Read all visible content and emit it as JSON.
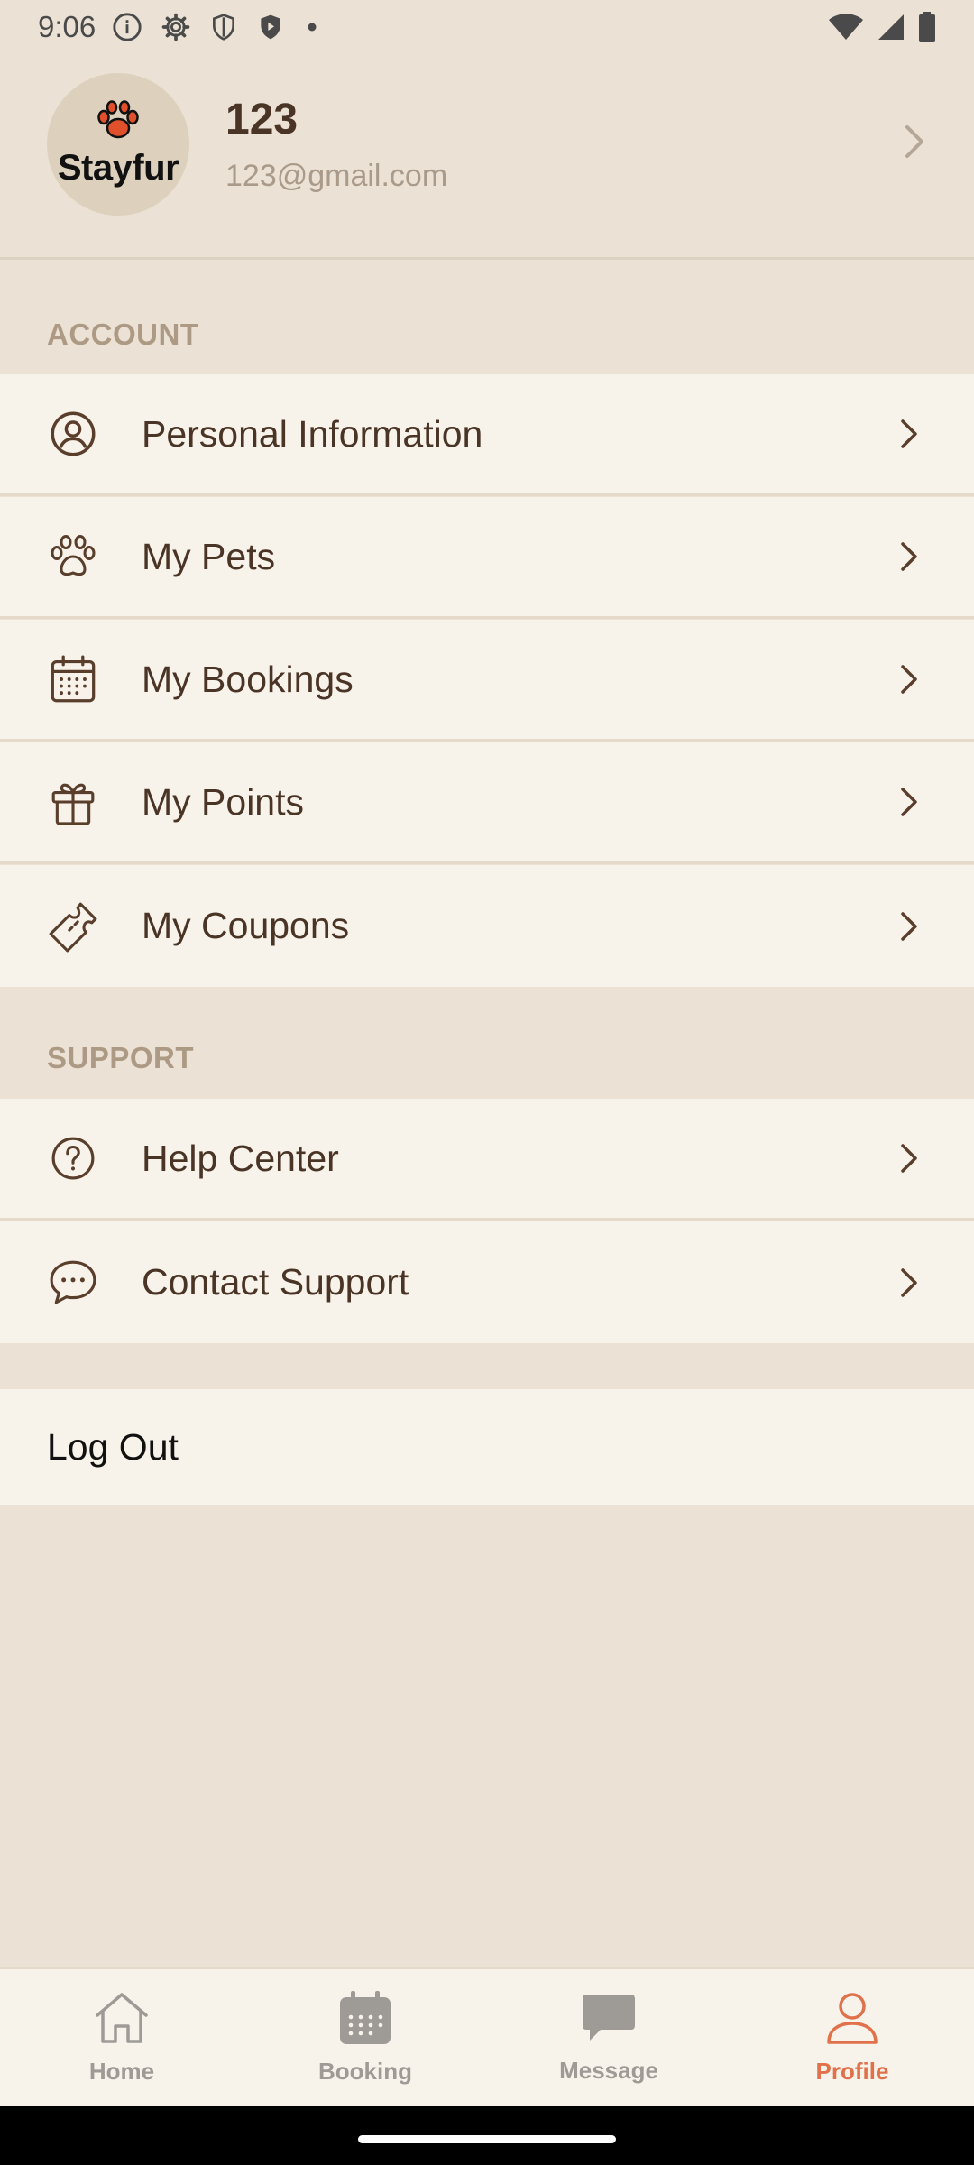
{
  "status_bar": {
    "time": "9:06",
    "icons_left": [
      "info-icon",
      "settings-icon",
      "shield-icon",
      "shield-filled-icon",
      "dot-icon"
    ],
    "icons_right": [
      "wifi-icon",
      "signal-icon",
      "battery-icon"
    ]
  },
  "profile": {
    "logo_text": "Stayfur",
    "name": "123",
    "email": "123@gmail.com"
  },
  "account": {
    "header": "ACCOUNT",
    "items": [
      {
        "label": "Personal Information",
        "icon": "user-circle-icon"
      },
      {
        "label": "My Pets",
        "icon": "paw-icon"
      },
      {
        "label": "My Bookings",
        "icon": "calendar-icon"
      },
      {
        "label": "My Points",
        "icon": "gift-icon"
      },
      {
        "label": "My Coupons",
        "icon": "ticket-icon"
      }
    ]
  },
  "support": {
    "header": "SUPPORT",
    "items": [
      {
        "label": "Help Center",
        "icon": "help-circle-icon"
      },
      {
        "label": "Contact Support",
        "icon": "chat-icon"
      }
    ]
  },
  "logout": {
    "label": "Log Out"
  },
  "bottom_nav": {
    "items": [
      {
        "label": "Home",
        "icon": "home-icon"
      },
      {
        "label": "Booking",
        "icon": "calendar-icon"
      },
      {
        "label": "Message",
        "icon": "message-icon"
      },
      {
        "label": "Profile",
        "icon": "profile-icon"
      }
    ],
    "active": "Profile"
  },
  "colors": {
    "background": "#ebe1d4",
    "row_background": "#f8f3ea",
    "text_primary": "#4a3426",
    "section_header": "#ad9a84",
    "accent": "#e0714b",
    "nav_inactive": "#9e9a96"
  }
}
